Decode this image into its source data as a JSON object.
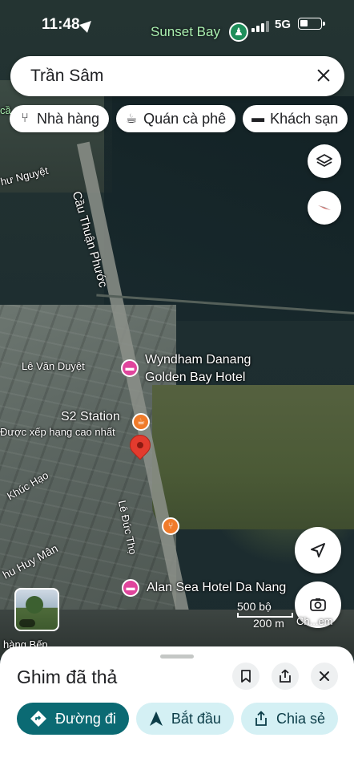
{
  "status_bar": {
    "time": "11:48",
    "network": "5G"
  },
  "search": {
    "query": "Trần Sâm"
  },
  "chips": [
    {
      "label": "Nhà hàng",
      "icon": "fork-knife-icon"
    },
    {
      "label": "Quán cà phê",
      "icon": "coffee-icon"
    },
    {
      "label": "Khách sạn",
      "icon": "bed-icon"
    }
  ],
  "map": {
    "places": {
      "sunset_bay": "Sunset Bay",
      "wyndham_line1": "Wyndham Danang",
      "wyndham_line2": "Golden Bay Hotel",
      "s2_station": "S2 Station",
      "s2_rating": "Được xếp hạng cao nhất",
      "alan_sea": "Alan Sea Hotel Da Nang"
    },
    "roads": {
      "nhu_nguyet": "hư Nguyệt",
      "cau_thuan_phuoc": "Cầu Thuận Phước",
      "le_van_duyet": "Lê Văn Duyệt",
      "khuc_hao": "Khúc Hạo",
      "le_duc_tho": "Lê Đức Thọ",
      "nhu_huy_man": "hu Huy Mân",
      "hang_bep": "hàng Bếp",
      "edge_label": "cầ"
    },
    "scale": {
      "imperial": "500 bộ",
      "metric": "200 m"
    },
    "lens_label": "Ch...em"
  },
  "sheet": {
    "title": "Ghim đã thả",
    "actions": {
      "directions": "Đường đi",
      "start": "Bắt đầu",
      "share": "Chia sẻ"
    }
  },
  "colors": {
    "primary": "#0b6a73",
    "secondary": "#d4f0f4",
    "pin": "#e33b2e",
    "hotel": "#e0459c",
    "food": "#f07b2a"
  }
}
